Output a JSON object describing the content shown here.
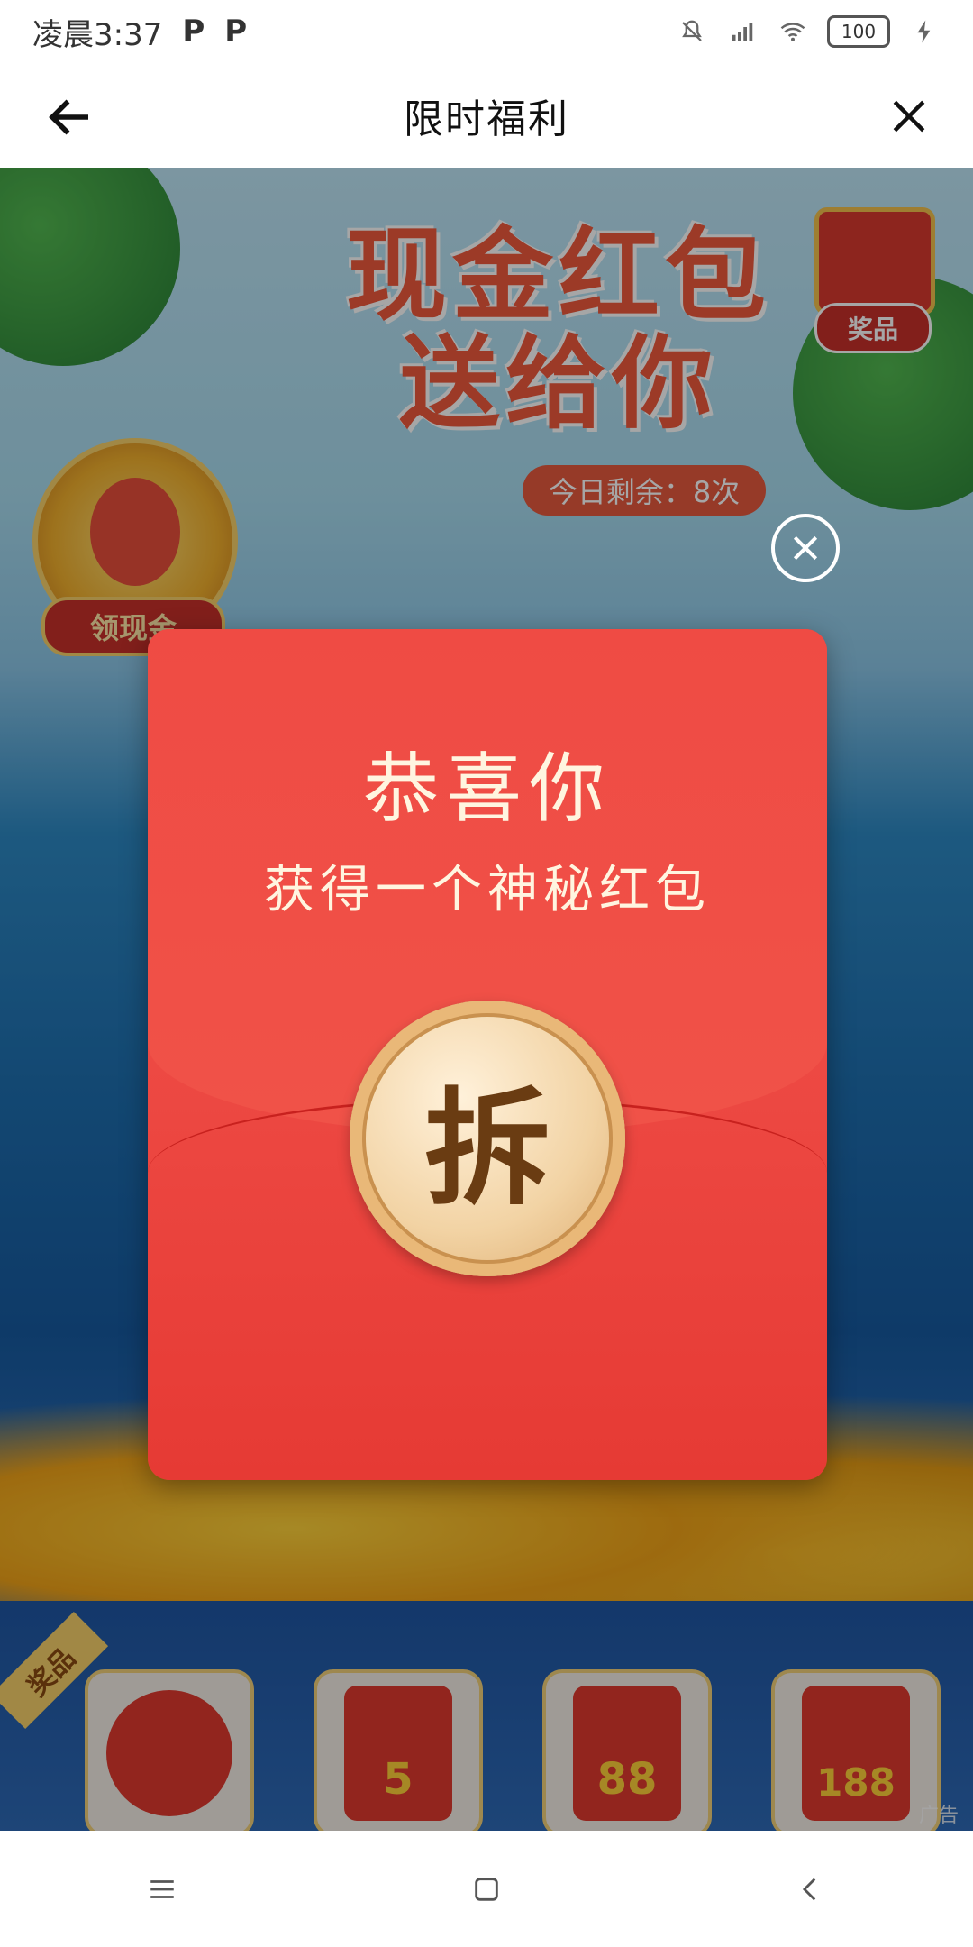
{
  "status_bar": {
    "time": "凌晨3:37",
    "battery": "100"
  },
  "header": {
    "title": "限时福利"
  },
  "game": {
    "headline_line1": "现金红包",
    "headline_line2": "送给你",
    "remaining": "今日剩余：8次",
    "god_label": "领现金",
    "gift_label": "奖品",
    "prize_tag": "奖品",
    "prizes": [
      {
        "value": ""
      },
      {
        "value": "5"
      },
      {
        "value": "88"
      },
      {
        "value": "188"
      }
    ],
    "ad_mark": "广告"
  },
  "dialog": {
    "title": "恭喜你",
    "subtitle": "获得一个神秘红包",
    "open_button": "拆"
  },
  "icons": {
    "back": "back-arrow-icon",
    "close": "close-icon",
    "dialog_close": "circle-close-icon",
    "nav_menu": "menu-icon",
    "nav_home": "home-square-icon",
    "nav_back": "nav-back-icon"
  },
  "colors": {
    "envelope": "#e83a34",
    "button_gold": "#f2d3a4",
    "title_red": "#f05a3d"
  }
}
